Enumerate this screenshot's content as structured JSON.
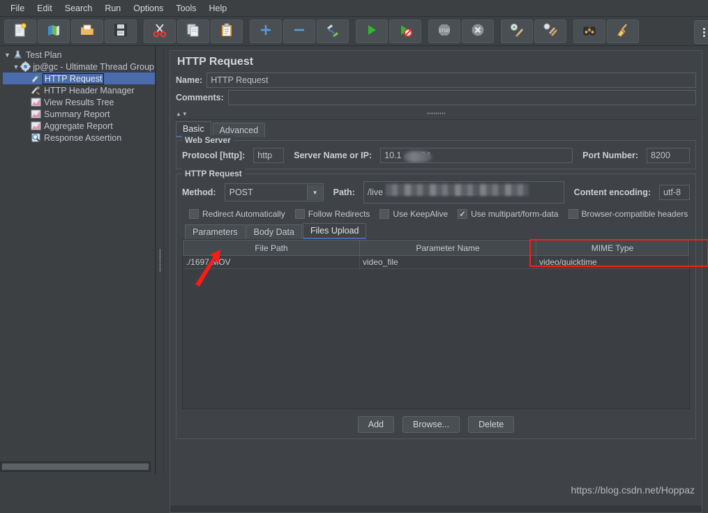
{
  "menubar": {
    "items": [
      {
        "label": "File",
        "mnemonic": "F"
      },
      {
        "label": "Edit",
        "mnemonic": "E"
      },
      {
        "label": "Search",
        "mnemonic": "S"
      },
      {
        "label": "Run",
        "mnemonic": "R"
      },
      {
        "label": "Options",
        "mnemonic": "O"
      },
      {
        "label": "Tools",
        "mnemonic": "T"
      },
      {
        "label": "Help",
        "mnemonic": "H"
      }
    ]
  },
  "toolbar": {
    "buttons": [
      {
        "icon": "new-document-icon",
        "name": "new-test-plan-button"
      },
      {
        "icon": "templates-icon",
        "name": "templates-button"
      },
      {
        "icon": "open-folder-icon",
        "name": "open-button"
      },
      {
        "icon": "save-floppy-icon",
        "name": "save-button"
      },
      {
        "icon": "cut-scissors-icon",
        "name": "cut-button"
      },
      {
        "icon": "copy-pages-icon",
        "name": "copy-button"
      },
      {
        "icon": "paste-clipboard-icon",
        "name": "paste-button"
      },
      {
        "icon": "plus-icon",
        "name": "expand-button"
      },
      {
        "icon": "minus-icon",
        "name": "collapse-button"
      },
      {
        "icon": "toggle-icon",
        "name": "toggle-button"
      },
      {
        "icon": "play-icon",
        "name": "start-button"
      },
      {
        "icon": "play-no-timers-icon",
        "name": "start-no-pauses-button"
      },
      {
        "icon": "stop-icon",
        "name": "stop-button"
      },
      {
        "icon": "shutdown-icon",
        "name": "shutdown-button"
      },
      {
        "icon": "clear-icon",
        "name": "clear-button"
      },
      {
        "icon": "clear-all-icon",
        "name": "clear-all-button"
      },
      {
        "icon": "binoculars-icon",
        "name": "search-button"
      },
      {
        "icon": "broom-icon",
        "name": "reset-search-button"
      }
    ],
    "overflow_label": "⋮"
  },
  "tree": {
    "items": [
      {
        "label": "Test Plan",
        "icon": "test-plan-icon",
        "depth": 0,
        "toggle": "▼",
        "selected": false
      },
      {
        "label": "jp@gc - Ultimate Thread Group",
        "icon": "thread-group-icon",
        "depth": 1,
        "toggle": "▼",
        "selected": false
      },
      {
        "label": "HTTP Request",
        "icon": "http-request-icon",
        "depth": 2,
        "toggle": "",
        "selected": true
      },
      {
        "label": "HTTP Header Manager",
        "icon": "header-manager-icon",
        "depth": 2,
        "toggle": "",
        "selected": false
      },
      {
        "label": "View Results Tree",
        "icon": "results-tree-icon",
        "depth": 2,
        "toggle": "",
        "selected": false
      },
      {
        "label": "Summary Report",
        "icon": "summary-report-icon",
        "depth": 2,
        "toggle": "",
        "selected": false
      },
      {
        "label": "Aggregate Report",
        "icon": "aggregate-report-icon",
        "depth": 2,
        "toggle": "",
        "selected": false
      },
      {
        "label": "Response Assertion",
        "icon": "assertion-icon",
        "depth": 2,
        "toggle": "",
        "selected": false
      }
    ]
  },
  "panel": {
    "title": "HTTP Request",
    "name_label": "Name:",
    "name_value": "HTTP Request",
    "comments_label": "Comments:",
    "comments_value": "",
    "tabs": [
      {
        "label": "Basic",
        "active": true
      },
      {
        "label": "Advanced",
        "active": false
      }
    ],
    "web_server": {
      "legend": "Web Server",
      "protocol_label": "Protocol [http]:",
      "protocol_value": "http",
      "server_label": "Server Name or IP:",
      "server_value": "10.1        24",
      "port_label": "Port Number:",
      "port_value": "8200"
    },
    "http_request": {
      "legend": "HTTP Request",
      "method_label": "Method:",
      "method_value": "POST",
      "path_label": "Path:",
      "path_value": "/live                              eless",
      "encoding_label": "Content encoding:",
      "encoding_value": "utf-8",
      "checkboxes": [
        {
          "label": "Redirect Automatically",
          "checked": false
        },
        {
          "label": "Follow Redirects",
          "checked": false
        },
        {
          "label": "Use KeepAlive",
          "checked": false
        },
        {
          "label": "Use multipart/form-data",
          "checked": true
        },
        {
          "label": "Browser-compatible headers",
          "checked": false
        }
      ],
      "inner_tabs": [
        {
          "label": "Parameters",
          "active": false
        },
        {
          "label": "Body Data",
          "active": false
        },
        {
          "label": "Files Upload",
          "active": true
        }
      ],
      "table": {
        "columns": [
          "File Path",
          "Parameter Name",
          "MIME Type"
        ],
        "rows": [
          [
            "./1697.MOV",
            "video_file",
            "video/quicktime"
          ]
        ],
        "highlight_color": "#ff1a14",
        "highlighted_column": "MIME Type"
      },
      "buttons": [
        {
          "label": "Add",
          "name": "add-button"
        },
        {
          "label": "Browse...",
          "name": "browse-button"
        },
        {
          "label": "Delete",
          "name": "delete-button"
        }
      ]
    }
  },
  "annotations": {
    "arrow_color": "#ff1a14",
    "watermark": "https://blog.csdn.net/Hoppaz"
  }
}
